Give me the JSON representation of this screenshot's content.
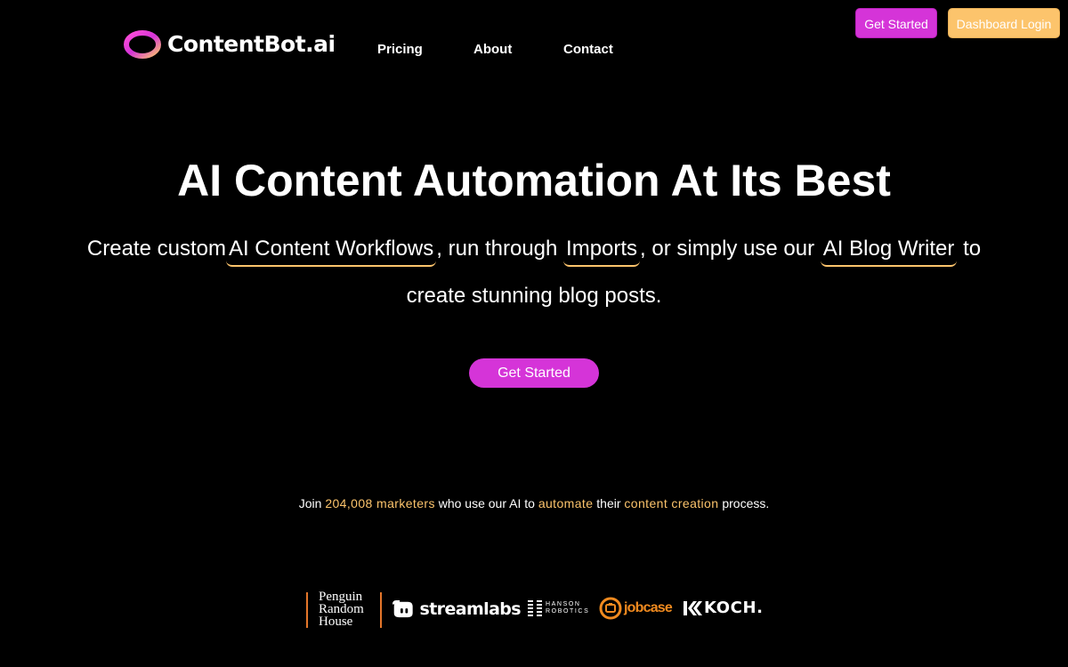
{
  "header": {
    "logo_text": "ContentBot.ai",
    "nav": {
      "pricing": "Pricing",
      "about": "About",
      "contact": "Contact"
    },
    "get_started": "Get Started",
    "dashboard_login": "Dashboard Login"
  },
  "hero": {
    "title": "AI Content Automation At Its Best",
    "sub_part1": "Create custom",
    "link_workflows": "AI Content Workflows",
    "sub_part2": ", run through",
    "link_imports": "Imports",
    "sub_part3": ", or simply use our",
    "link_blog_writer": "AI Blog Writer",
    "sub_part4": "to",
    "sub_line2": "create stunning blog posts.",
    "cta": "Get Started"
  },
  "social_proof": {
    "join": "Join",
    "count": "204,008 marketers",
    "mid1": "who use our AI to",
    "automate": "automate",
    "mid2": "their",
    "content_creation": "content creation",
    "end": "process."
  },
  "logos": {
    "penguin_line1": "Penguin",
    "penguin_line2": "Random",
    "penguin_line3": "House",
    "streamlabs": "streamlabs",
    "hanson_line1": "HANSON",
    "hanson_line2": "ROBOTICS",
    "jobcase": "jobcase",
    "koch": "KOCH."
  },
  "colors": {
    "background": "#000000",
    "primary_magenta": "#d534d8",
    "accent_gold": "#fcc46c",
    "jobcase_orange": "#f08a1f",
    "penguin_orange": "#e4762a"
  },
  "icons": {
    "logo": "contentbot-ring-icon",
    "streamlabs": "streamlabs-mascot-icon",
    "hanson": "hanson-stripes-icon",
    "jobcase": "jobcase-circle-icon",
    "koch": "koch-k-icon"
  }
}
